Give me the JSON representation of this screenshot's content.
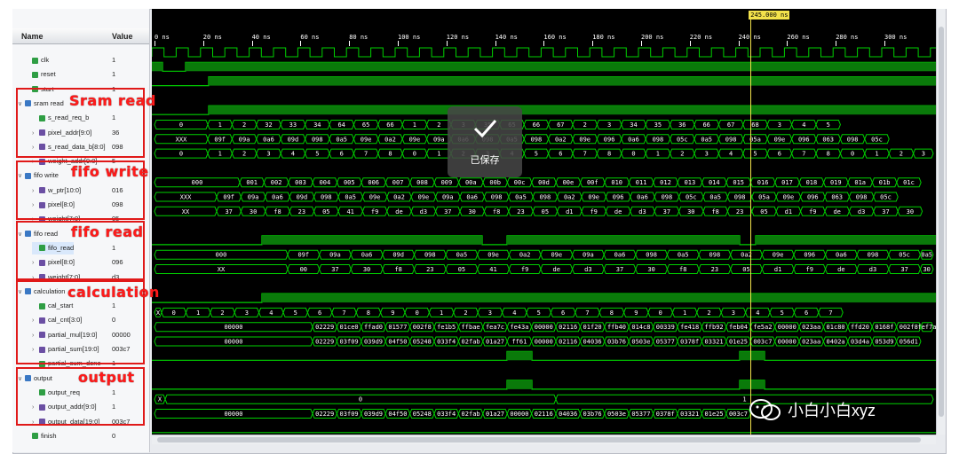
{
  "columns": {
    "name": "Name",
    "value": "Value"
  },
  "cursor": {
    "label": "245.000 ns",
    "time_ns": 245
  },
  "ruler": {
    "labels": [
      "0 ns",
      "20 ns",
      "40 ns",
      "60 ns",
      "80 ns",
      "100 ns",
      "120 ns",
      "140 ns",
      "160 ns",
      "180 ns",
      "200 ns",
      "220 ns",
      "240 ns",
      "260 ns",
      "280 ns",
      "300 ns"
    ]
  },
  "signals": [
    {
      "name": "clk",
      "value": "1",
      "kind": "bit",
      "indent": 1
    },
    {
      "name": "reset",
      "value": "1",
      "kind": "bit",
      "indent": 1
    },
    {
      "name": "start",
      "value": "1",
      "kind": "bit",
      "indent": 1
    },
    {
      "name": "sram read",
      "value": "",
      "kind": "grp",
      "indent": 0
    },
    {
      "name": "s_read_req_b",
      "value": "1",
      "kind": "bit",
      "indent": 2
    },
    {
      "name": "pixel_addr[9:0]",
      "value": "36",
      "kind": "bus",
      "indent": 2
    },
    {
      "name": "s_read_data_b[8:0]",
      "value": "098",
      "kind": "bus",
      "indent": 2
    },
    {
      "name": "weight_addr[9:0]",
      "value": "5",
      "kind": "bus",
      "indent": 2
    },
    {
      "name": "fifo write",
      "value": "",
      "kind": "grp",
      "indent": 0
    },
    {
      "name": "w_ptr[10:0]",
      "value": "016",
      "kind": "bus",
      "indent": 2
    },
    {
      "name": "pixel[8:0]",
      "value": "098",
      "kind": "bus",
      "indent": 2
    },
    {
      "name": "weight[7:0]",
      "value": "05",
      "kind": "bus",
      "indent": 2
    },
    {
      "name": "fifo read",
      "value": "",
      "kind": "grp",
      "indent": 0
    },
    {
      "name": "fifo_read",
      "value": "1",
      "kind": "bit",
      "indent": 2
    },
    {
      "name": "pixel[8:0]",
      "value": "096",
      "kind": "bus",
      "indent": 2
    },
    {
      "name": "weight[7:0]",
      "value": "d3",
      "kind": "bus",
      "indent": 2
    },
    {
      "name": "calculation",
      "value": "",
      "kind": "grp",
      "indent": 0
    },
    {
      "name": "cal_start",
      "value": "1",
      "kind": "bit",
      "indent": 2
    },
    {
      "name": "cal_cnt[3:0]",
      "value": "0",
      "kind": "bus",
      "indent": 2
    },
    {
      "name": "partial_mul[19:0]",
      "value": "00000",
      "kind": "bus",
      "indent": 2
    },
    {
      "name": "partial_sum[19:0]",
      "value": "003c7",
      "kind": "bus",
      "indent": 2
    },
    {
      "name": "partial_sum_done",
      "value": "1",
      "kind": "bit",
      "indent": 2
    },
    {
      "name": "output",
      "value": "",
      "kind": "grp",
      "indent": 0
    },
    {
      "name": "output_req",
      "value": "1",
      "kind": "bit",
      "indent": 2
    },
    {
      "name": "output_addr[9:0]",
      "value": "1",
      "kind": "bus",
      "indent": 2
    },
    {
      "name": "output_data[19:0]",
      "value": "003c7",
      "kind": "bus",
      "indent": 2
    },
    {
      "name": "finish",
      "value": "0",
      "kind": "bit",
      "indent": 1
    }
  ],
  "annotations": [
    "Sram read",
    "fifo write",
    "fifo read",
    "calculation",
    "output"
  ],
  "buses": {
    "pixel_addr": [
      "0",
      "1",
      "2",
      "32",
      "33",
      "34",
      "64",
      "65",
      "66",
      "1",
      "2",
      "3",
      "35",
      "65",
      "66",
      "67",
      "2",
      "3",
      "34",
      "35",
      "36",
      "66",
      "67",
      "68",
      "3",
      "4",
      "5"
    ],
    "s_read_data_b": [
      "XXX",
      "09f",
      "09a",
      "0a6",
      "09d",
      "098",
      "0a5",
      "09e",
      "0a2",
      "09e",
      "09a",
      "0a6",
      "098",
      "0a5",
      "098",
      "0a2",
      "09e",
      "096",
      "0a6",
      "098",
      "05c",
      "0a5",
      "098",
      "05a",
      "09e",
      "096",
      "063",
      "098",
      "05c"
    ],
    "weight_addr": [
      "0",
      "1",
      "2",
      "3",
      "4",
      "5",
      "6",
      "7",
      "8",
      "0",
      "1",
      "2",
      "3",
      "4",
      "5",
      "6",
      "7",
      "8",
      "0",
      "1",
      "2",
      "3",
      "4",
      "5",
      "6",
      "7",
      "8",
      "0",
      "1",
      "2",
      "3"
    ],
    "w_ptr": [
      "000",
      "001",
      "002",
      "003",
      "004",
      "005",
      "006",
      "007",
      "008",
      "009",
      "00a",
      "00b",
      "00c",
      "00d",
      "00e",
      "00f",
      "010",
      "011",
      "012",
      "013",
      "014",
      "015",
      "016",
      "017",
      "018",
      "019",
      "01a",
      "01b",
      "01c"
    ],
    "pixel_w": [
      "XXX",
      "09f",
      "09a",
      "0a6",
      "09d",
      "098",
      "0a5",
      "09e",
      "0a2",
      "09e",
      "09a",
      "0a6",
      "098",
      "0a5",
      "098",
      "0a2",
      "09e",
      "096",
      "0a6",
      "098",
      "05c",
      "0a5",
      "098",
      "05a",
      "09e",
      "096",
      "063",
      "098",
      "05c"
    ],
    "weight_w": [
      "XX",
      "37",
      "30",
      "f8",
      "23",
      "05",
      "41",
      "f9",
      "de",
      "d3",
      "37",
      "30",
      "f8",
      "23",
      "05",
      "d1",
      "f9",
      "de",
      "d3",
      "37",
      "30",
      "f8",
      "23",
      "05",
      "d1",
      "f9",
      "de",
      "d3",
      "37",
      "30"
    ],
    "pixel_r": [
      "000",
      "09f",
      "09a",
      "0a6",
      "09d",
      "098",
      "0a5",
      "09e",
      "0a2",
      "09e",
      "09a",
      "0a6",
      "098",
      "0a5",
      "098",
      "0a2",
      "09e",
      "096",
      "0a6",
      "098",
      "05c",
      "0a5",
      "098",
      "05a"
    ],
    "weight_r": [
      "XX",
      "00",
      "37",
      "30",
      "f8",
      "23",
      "05",
      "41",
      "f9",
      "de",
      "d3",
      "37",
      "30",
      "f8",
      "23",
      "05",
      "d1",
      "f9",
      "de",
      "d3",
      "37",
      "30",
      "f8",
      "23",
      "05",
      "d1"
    ],
    "cal_cnt": [
      "X",
      "0",
      "1",
      "2",
      "3",
      "4",
      "5",
      "6",
      "7",
      "8",
      "9",
      "0",
      "1",
      "2",
      "3",
      "4",
      "5",
      "6",
      "7",
      "8",
      "9",
      "0",
      "1",
      "2",
      "3",
      "4",
      "5",
      "6",
      "7"
    ],
    "partial_mul": [
      "00000",
      "02229",
      "01ce0",
      "ffad0",
      "01577",
      "002f8",
      "fe1b5",
      "ffbae",
      "fea7c",
      "fe43a",
      "00000",
      "02116",
      "01f20",
      "ffb40",
      "014c8",
      "00339",
      "fe418",
      "ffb92",
      "feb04",
      "fe5a2",
      "00000",
      "023aa",
      "01c80",
      "ffd20",
      "0168f",
      "002f8",
      "fef7a"
    ],
    "partial_sum": [
      "00000",
      "02229",
      "03f09",
      "039d9",
      "04f50",
      "05248",
      "033f4",
      "02fab",
      "01a27",
      "ff61",
      "00000",
      "02116",
      "04036",
      "03b76",
      "0503e",
      "05377",
      "0378f",
      "03321",
      "01e25",
      "003c7",
      "00000",
      "023aa",
      "0402a",
      "03d4a",
      "053d9",
      "056d1"
    ],
    "output_addr": [
      "X",
      "0",
      "1",
      "2"
    ],
    "output_data": [
      "00000",
      "02229",
      "03f09",
      "039d9",
      "04f50",
      "05248",
      "033f4",
      "02fab",
      "01a27",
      "00000",
      "02116",
      "04036",
      "03b76",
      "0503e",
      "05377",
      "0378f",
      "03321",
      "01e25",
      "003c7"
    ]
  },
  "toast": {
    "text": "已保存"
  },
  "watermark": {
    "text": "小白小白xyz"
  }
}
